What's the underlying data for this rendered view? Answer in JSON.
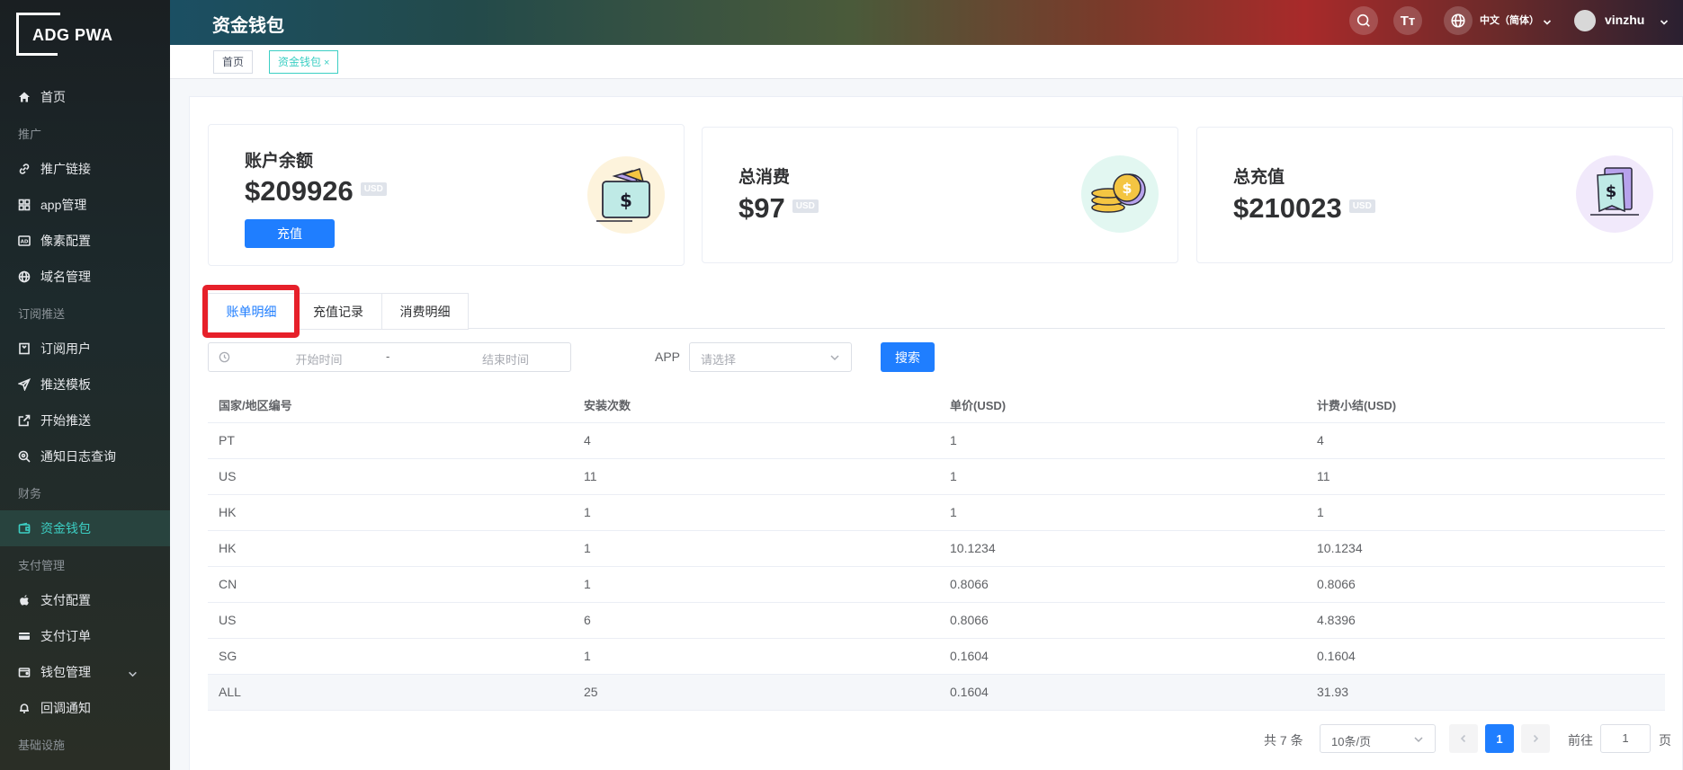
{
  "brand": {
    "logo_text": "ADG PWA"
  },
  "sidebar": {
    "items": [
      {
        "type": "item",
        "label": "首页",
        "icon": "home-icon"
      },
      {
        "type": "group",
        "label": "推广"
      },
      {
        "type": "item",
        "label": "推广链接",
        "icon": "link-icon"
      },
      {
        "type": "item",
        "label": "app管理",
        "icon": "grid-icon"
      },
      {
        "type": "item",
        "label": "像素配置",
        "icon": "ad-icon"
      },
      {
        "type": "item",
        "label": "域名管理",
        "icon": "globe-icon"
      },
      {
        "type": "group",
        "label": "订阅推送"
      },
      {
        "type": "item",
        "label": "订阅用户",
        "icon": "bookmark-icon"
      },
      {
        "type": "item",
        "label": "推送模板",
        "icon": "send-icon"
      },
      {
        "type": "item",
        "label": "开始推送",
        "icon": "external-icon"
      },
      {
        "type": "item",
        "label": "通知日志查询",
        "icon": "search-zoom-icon"
      },
      {
        "type": "group",
        "label": "财务"
      },
      {
        "type": "item",
        "label": "资金钱包",
        "icon": "wallet-icon",
        "active": true
      },
      {
        "type": "group",
        "label": "支付管理"
      },
      {
        "type": "item",
        "label": "支付配置",
        "icon": "apple-icon"
      },
      {
        "type": "item",
        "label": "支付订单",
        "icon": "card-icon"
      },
      {
        "type": "item",
        "label": "钱包管理",
        "icon": "wallet-alt-icon",
        "expandable": true
      },
      {
        "type": "item",
        "label": "回调通知",
        "icon": "bell-icon"
      },
      {
        "type": "group",
        "label": "基础设施"
      }
    ]
  },
  "header": {
    "title": "资金钱包",
    "language": "中文（简体）",
    "username": "vinzhu",
    "font_icon_text": "Tт"
  },
  "tags": {
    "home": "首页",
    "current": "资金钱包",
    "close": "×"
  },
  "stats": {
    "balance": {
      "title": "账户余额",
      "value": "$209926",
      "unit": "USD",
      "button": "充值"
    },
    "spent": {
      "title": "总消费",
      "value": "$97",
      "unit": "USD"
    },
    "recharged": {
      "title": "总充值",
      "value": "$210023",
      "unit": "USD"
    }
  },
  "tabs": [
    "账单明细",
    "充值记录",
    "消费明细"
  ],
  "filters": {
    "start_placeholder": "开始时间",
    "separator": "-",
    "end_placeholder": "结束时间",
    "app_label": "APP",
    "app_placeholder": "请选择",
    "search_button": "搜索"
  },
  "table": {
    "headers": [
      "国家/地区编号",
      "安装次数",
      "单价(USD)",
      "计费小结(USD)"
    ],
    "rows": [
      [
        "PT",
        "4",
        "1",
        "4"
      ],
      [
        "US",
        "11",
        "1",
        "11"
      ],
      [
        "HK",
        "1",
        "1",
        "1"
      ],
      [
        "HK",
        "1",
        "10.1234",
        "10.1234"
      ],
      [
        "CN",
        "1",
        "0.8066",
        "0.8066"
      ],
      [
        "US",
        "6",
        "0.8066",
        "4.8396"
      ],
      [
        "SG",
        "1",
        "0.1604",
        "0.1604"
      ],
      [
        "ALL",
        "25",
        "0.1604",
        "31.93"
      ]
    ]
  },
  "pagination": {
    "total": "共 7 条",
    "page_size": "10条/页",
    "current_page": "1",
    "goto_label": "前往",
    "goto_value": "1",
    "page_suffix": "页"
  },
  "colors": {
    "primary": "#1f7eff",
    "accent_teal": "#3ccfc4",
    "highlight_red": "#e6202a"
  }
}
